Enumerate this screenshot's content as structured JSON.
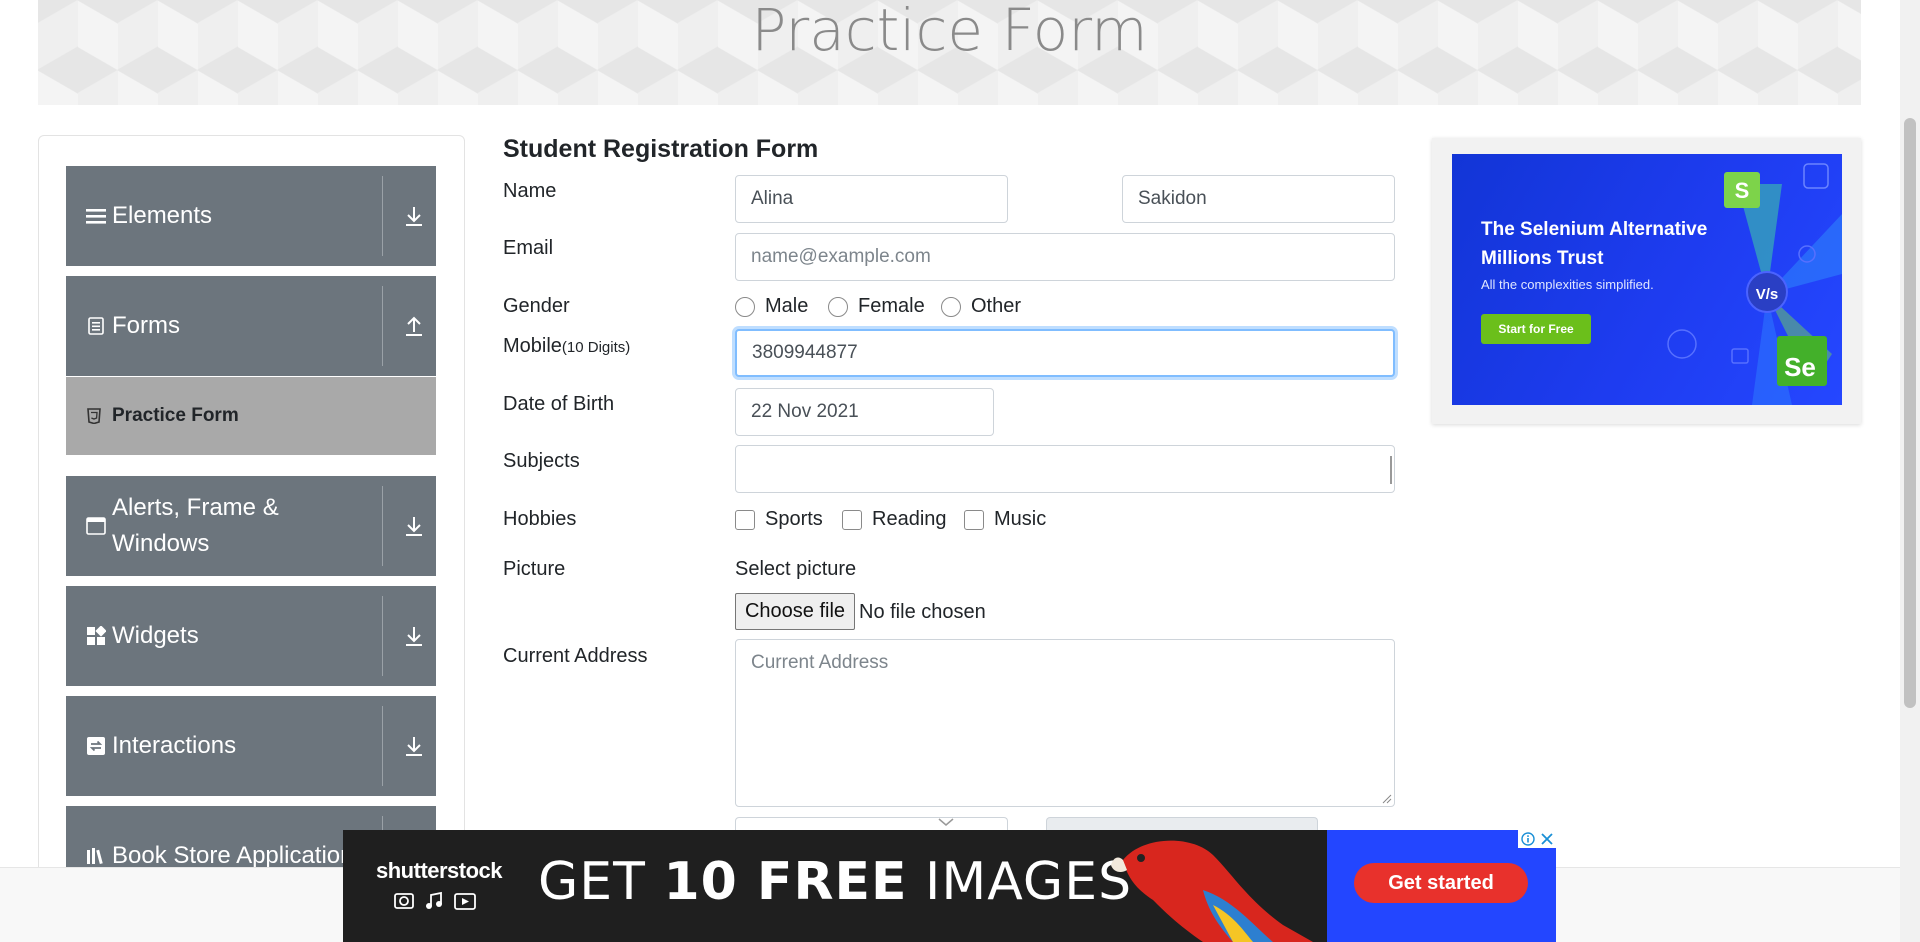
{
  "page": {
    "title": "Practice Form"
  },
  "sidebar": {
    "groups": [
      {
        "label": "Elements",
        "icon": "hamburger-icon",
        "expanded": false
      },
      {
        "label": "Forms",
        "icon": "document-icon",
        "expanded": true
      },
      {
        "label": "Alerts, Frame & Windows",
        "icon": "window-icon",
        "expanded": false
      },
      {
        "label": "Widgets",
        "icon": "widgets-icon",
        "expanded": false
      },
      {
        "label": "Interactions",
        "icon": "interactions-icon",
        "expanded": false
      },
      {
        "label": "Book Store Application",
        "icon": "books-icon",
        "expanded": false
      }
    ],
    "active_item": {
      "label": "Practice Form",
      "icon": "html5-icon"
    }
  },
  "form": {
    "title": "Student Registration Form",
    "name_label": "Name",
    "first_name": "Alina",
    "last_name": "Sakidon",
    "email_label": "Email",
    "email_placeholder": "name@example.com",
    "gender_label": "Gender",
    "gender_options": [
      "Male",
      "Female",
      "Other"
    ],
    "mobile_label": "Mobile",
    "mobile_hint": "(10 Digits)",
    "mobile_value": "3809944877",
    "dob_label": "Date of Birth",
    "dob_value": "22 Nov 2021",
    "subjects_label": "Subjects",
    "subjects_value": "",
    "hobbies_label": "Hobbies",
    "hobbies_options": [
      "Sports",
      "Reading",
      "Music"
    ],
    "picture_label": "Picture",
    "select_picture": "Select picture",
    "choose_file": "Choose file",
    "no_file": "No file chosen",
    "address_label": "Current Address",
    "address_placeholder": "Current Address"
  },
  "ads": {
    "right": {
      "headline": "The Selenium Alternative Millions Trust",
      "sub": "All the complexities simplified.",
      "cta": "Start for Free",
      "vs": "V/s"
    },
    "bottom": {
      "brand": "shutterstock",
      "headline_pre": "GET ",
      "headline_bold": "10 FREE",
      "headline_post": " IMAGES",
      "cta": "Get started"
    }
  },
  "colors": {
    "sidebar_group": "#6c757d",
    "active_item": "#a9a9a9",
    "focus_border": "#80bdff",
    "ad_blue": "#2346ff",
    "ad_cta_red": "#e8312c",
    "ad_cta_green": "#6bbf1b"
  }
}
